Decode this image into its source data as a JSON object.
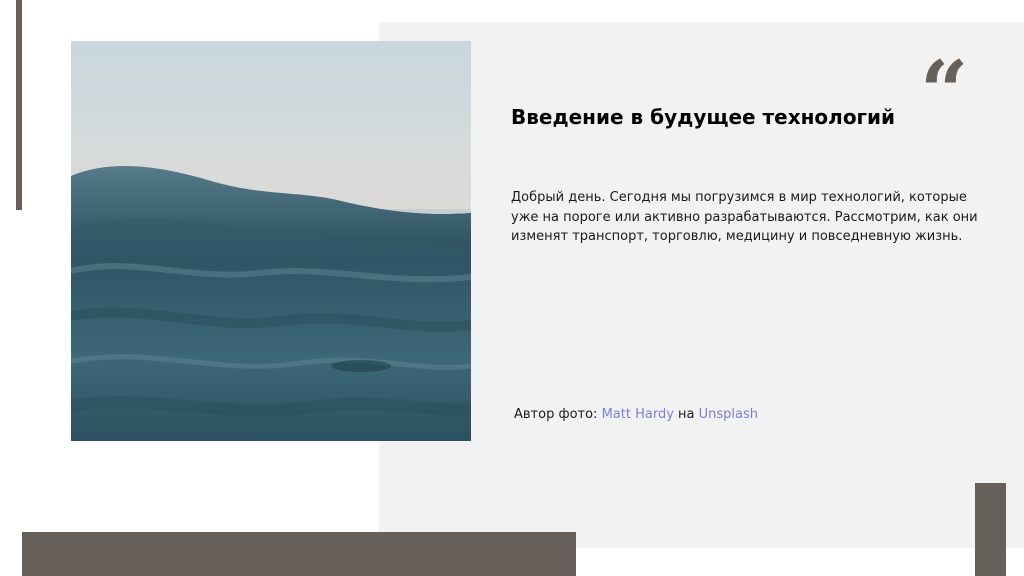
{
  "slide": {
    "quote_mark": "“",
    "title": "Введение в будущее технологий",
    "body": "Добрый день. Сегодня мы погрузимся в мир технологий, которые уже на пороге или активно разрабатываются. Рассмотрим, как они изменят транспорт, торговлю, медицину и повседневную жизнь.",
    "credit": {
      "prefix": "Автор фото: ",
      "author": "Matt Hardy",
      "connector": " на ",
      "source": "Unsplash"
    }
  },
  "colors": {
    "accent_bars": "#665f5a",
    "panel": "#f2f2f2",
    "link": "#7b7fd0"
  },
  "image": {
    "subject": "ocean-wave-photo"
  }
}
